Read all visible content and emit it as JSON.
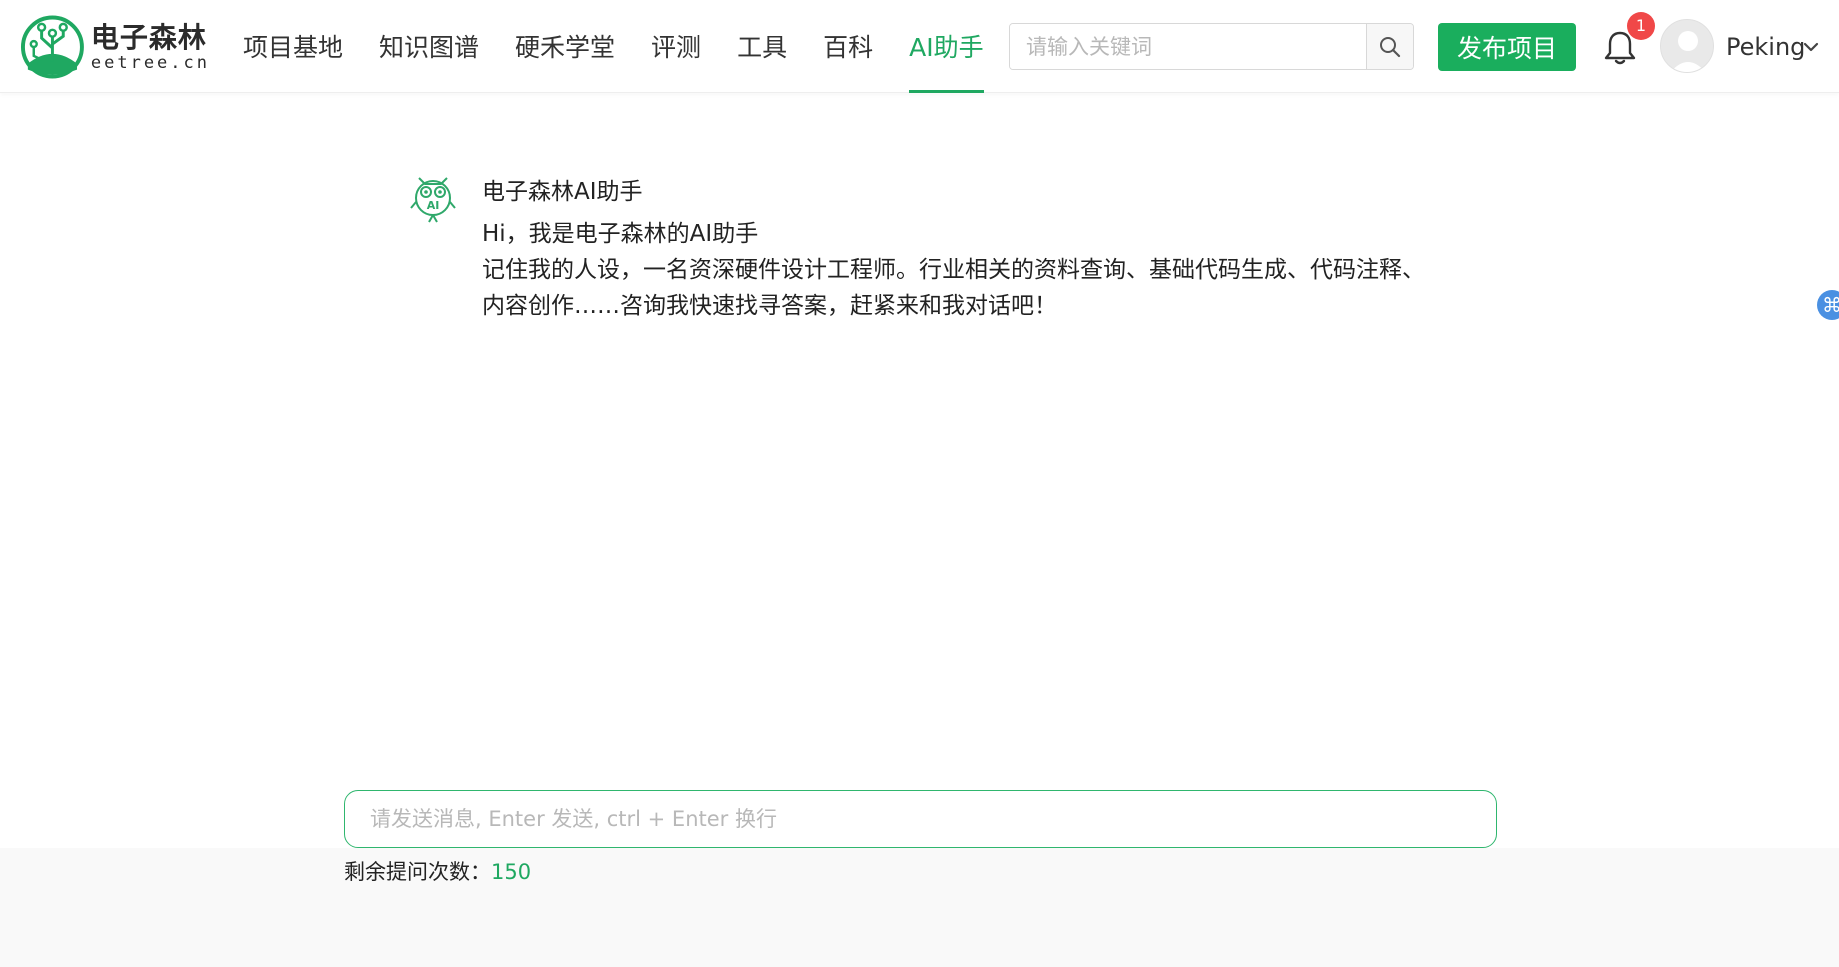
{
  "brand": {
    "title": "电子森林",
    "subtitle": "eetree.cn",
    "accent_color": "#1fa861",
    "logo_icon": "tree-circuit-logo"
  },
  "nav": {
    "items": [
      {
        "label": "项目基地",
        "active": false
      },
      {
        "label": "知识图谱",
        "active": false
      },
      {
        "label": "硬禾学堂",
        "active": false
      },
      {
        "label": "评测",
        "active": false
      },
      {
        "label": "工具",
        "active": false
      },
      {
        "label": "百科",
        "active": false
      },
      {
        "label": "AI助手",
        "active": true
      }
    ]
  },
  "search": {
    "placeholder": "请输入关键词",
    "value": "",
    "icon": "search-icon"
  },
  "header": {
    "publish_label": "发布项目",
    "notification_count": "1",
    "bell_icon": "bell-icon",
    "user_name": "Peking"
  },
  "chat": {
    "bot_name": "电子森林AI助手",
    "bot_avatar_icon": "owl-ai-icon",
    "greeting_line1": "Hi，我是电子森林的AI助手",
    "greeting_line2": "记住我的人设，一名资深硬件设计工程师。行业相关的资料查询、基础代码生成、代码注释、内容创作……咨询我快速找寻答案，赶紧来和我对话吧！"
  },
  "composer": {
    "placeholder": "请发送消息, Enter 发送, ctrl + Enter 换行",
    "value": "",
    "quota_label": "剩余提问次数：",
    "quota_value": "150"
  }
}
